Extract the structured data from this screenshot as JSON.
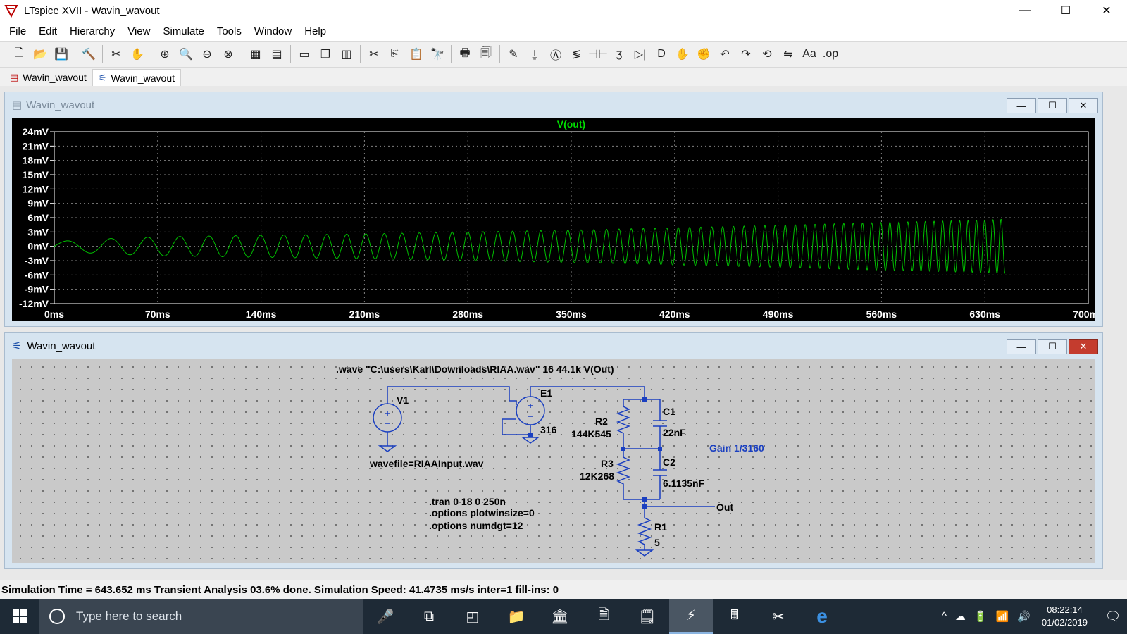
{
  "window": {
    "title": "LTspice XVII - Wavin_wavout",
    "minimize": "—",
    "maximize": "☐",
    "close": "✕"
  },
  "menu": [
    "File",
    "Edit",
    "Hierarchy",
    "View",
    "Simulate",
    "Tools",
    "Window",
    "Help"
  ],
  "toolbar": {
    "groups": [
      [
        "new-icon",
        "open-icon",
        "save-icon"
      ],
      [
        "control-panel-icon"
      ],
      [
        "run-icon",
        "pan-hand-icon"
      ],
      [
        "zoom-in-icon",
        "zoom-area-icon",
        "zoom-out-icon",
        "zoom-cancel-icon"
      ],
      [
        "autorange-icon",
        "grid-icon"
      ],
      [
        "tile-horizontal-icon",
        "cascade-icon",
        "tile-vertical-icon"
      ],
      [
        "cut-icon",
        "copy-icon",
        "paste-icon",
        "find-icon"
      ],
      [
        "print-icon",
        "print-preview-icon"
      ],
      [
        "wire-icon",
        "ground-icon",
        "label-icon",
        "resistor-icon",
        "capacitor-icon",
        "inductor-icon",
        "diode-icon",
        "component-icon",
        "move-icon",
        "drag-icon",
        "undo-icon",
        "redo-icon",
        "rotate-icon",
        "mirror-icon",
        "text-icon",
        "spice-directive-icon"
      ]
    ],
    "symbols": {
      "new-icon": "🗋",
      "open-icon": "📂",
      "save-icon": "💾",
      "control-panel-icon": "🔨",
      "run-icon": "✂",
      "pan-hand-icon": "✋",
      "zoom-in-icon": "⊕",
      "zoom-area-icon": "🔍",
      "zoom-out-icon": "⊖",
      "zoom-cancel-icon": "⊗",
      "autorange-icon": "▦",
      "grid-icon": "▤",
      "tile-horizontal-icon": "▭",
      "cascade-icon": "❐",
      "tile-vertical-icon": "▥",
      "cut-icon": "✂",
      "copy-icon": "⎘",
      "paste-icon": "📋",
      "find-icon": "🔭",
      "print-icon": "🖶",
      "print-preview-icon": "🗐",
      "wire-icon": "✎",
      "ground-icon": "⏚",
      "label-icon": "Ⓐ",
      "resistor-icon": "≶",
      "capacitor-icon": "⊣⊢",
      "inductor-icon": "ʒ",
      "diode-icon": "▷|",
      "component-icon": "D",
      "move-icon": "✋",
      "drag-icon": "✊",
      "undo-icon": "↶",
      "redo-icon": "↷",
      "rotate-icon": "⟲",
      "mirror-icon": "⇋",
      "text-icon": "Aa",
      "spice-directive-icon": ".op"
    }
  },
  "tabs": [
    {
      "label": "Wavin_wavout",
      "icon": "waveform-icon",
      "active": false
    },
    {
      "label": "Wavin_wavout",
      "icon": "schematic-icon",
      "active": true
    }
  ],
  "plot_window": {
    "title": "Wavin_wavout",
    "buttons": [
      "—",
      "☐",
      "✕"
    ]
  },
  "schematic_window": {
    "title": "Wavin_wavout",
    "buttons": [
      "—",
      "☐",
      "✕"
    ],
    "directive_wave": ".wave \"C:\\users\\Karl\\Downloads\\RIAA.wav\" 16 44.1k V(Out)",
    "v1_label": "V1",
    "v1_value": "wavefile=RIAAInput.wav",
    "e1_label": "E1",
    "e1_value": "316",
    "r2_label": "R2",
    "r2_value": "144K545",
    "c1_label": "C1",
    "c1_value": "22nF",
    "r3_label": "R3",
    "r3_value": "12K268",
    "c2_label": "C2",
    "c2_value": "6.1135nF",
    "gain_comment": "Gain 1/3160",
    "out_label": "Out",
    "r1_label": "R1",
    "r1_value": "5",
    "directive_tran": ".tran 0 18 0 250n",
    "directive_opt1": ".options plotwinsize=0",
    "directive_opt2": ".options numdgt=12"
  },
  "status": "Simulation Time = 643.652 ms  Transient Analysis 03.6% done. Simulation Speed: 41.4735 ms/s inter=1 fill-ins: 0",
  "taskbar": {
    "search_placeholder": "Type here to search",
    "apps": [
      "mic-icon",
      "task-view-icon",
      "outlook-icon",
      "file-explorer-icon",
      "bank-icon",
      "document-icon",
      "notes-icon",
      "ltspice-icon",
      "calculator-icon",
      "snipping-icon",
      "edge-icon"
    ],
    "app_symbols": {
      "mic-icon": "🎤",
      "task-view-icon": "⧉",
      "outlook-icon": "◰",
      "file-explorer-icon": "📁",
      "bank-icon": "🏛",
      "document-icon": "🗎",
      "notes-icon": "🗒",
      "ltspice-icon": "⚡",
      "calculator-icon": "🖩",
      "snipping-icon": "✂",
      "edge-icon": "e"
    },
    "time": "08:22:14",
    "date": "01/02/2019",
    "tray": [
      "^",
      "☁",
      "🔋",
      "📶",
      "🔊"
    ]
  },
  "chart_data": {
    "type": "line",
    "title": "V(out)",
    "series": [
      {
        "name": "V(out)",
        "color": "#00c000",
        "description_points": {
          "t_ms": [
            0,
            35,
            70,
            140,
            210,
            280,
            350,
            420,
            490,
            560,
            630,
            643.652
          ],
          "amplitude_mV": [
            1.0,
            1.6,
            2.0,
            2.3,
            2.6,
            3.0,
            3.4,
            3.9,
            4.4,
            5.0,
            5.5,
            5.7
          ]
        }
      }
    ],
    "xlabel": "",
    "ylabel": "",
    "x_ticks": [
      "0ms",
      "70ms",
      "140ms",
      "210ms",
      "280ms",
      "350ms",
      "420ms",
      "490ms",
      "560ms",
      "630ms",
      "700ms"
    ],
    "y_ticks": [
      "24mV",
      "21mV",
      "18mV",
      "15mV",
      "12mV",
      "9mV",
      "6mV",
      "3mV",
      "0mV",
      "-3mV",
      "-6mV",
      "-9mV",
      "-12mV"
    ],
    "xlim": [
      0,
      700
    ],
    "ylim": [
      -12,
      24
    ],
    "grid": true
  }
}
